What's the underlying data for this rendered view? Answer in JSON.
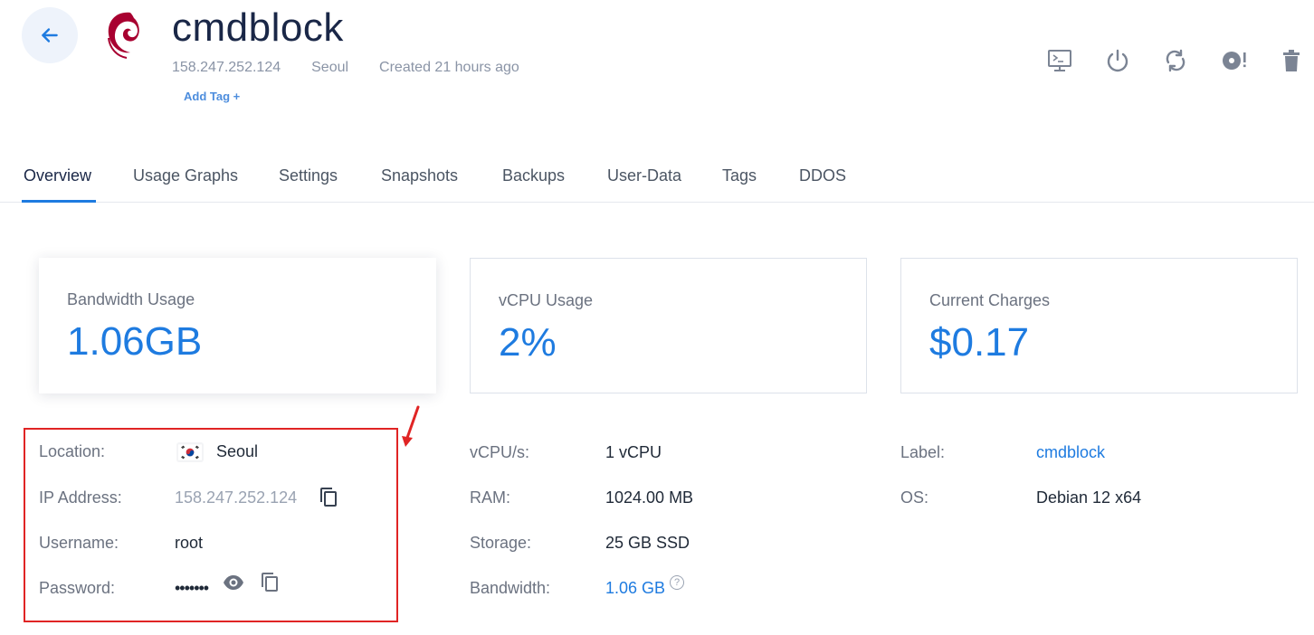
{
  "header": {
    "title": "cmdblock",
    "ip": "158.247.252.124",
    "location": "Seoul",
    "created": "Created 21 hours ago",
    "add_tag": "Add Tag +"
  },
  "actions": [
    "console-icon",
    "power-icon",
    "restart-icon",
    "reinstall-icon",
    "trash-icon"
  ],
  "tabs": [
    {
      "label": "Overview",
      "active": true
    },
    {
      "label": "Usage Graphs"
    },
    {
      "label": "Settings"
    },
    {
      "label": "Snapshots"
    },
    {
      "label": "Backups"
    },
    {
      "label": "User-Data"
    },
    {
      "label": "Tags"
    },
    {
      "label": "DDOS"
    }
  ],
  "cards": [
    {
      "label": "Bandwidth Usage",
      "value": "1.06GB"
    },
    {
      "label": "vCPU Usage",
      "value": "2%"
    },
    {
      "label": "Current Charges",
      "value": "$0.17"
    }
  ],
  "details": {
    "location": {
      "label": "Location:",
      "value": "Seoul"
    },
    "ip": {
      "label": "IP Address:",
      "value": "158.247.252.124"
    },
    "username": {
      "label": "Username:",
      "value": "root"
    },
    "password": {
      "label": "Password:",
      "value": "•••••••"
    },
    "vcpu": {
      "label": "vCPU/s:",
      "value": "1 vCPU"
    },
    "ram": {
      "label": "RAM:",
      "value": "1024.00 MB"
    },
    "storage": {
      "label": "Storage:",
      "value": "25 GB SSD"
    },
    "bandwidth": {
      "label": "Bandwidth:",
      "value": "1.06 GB"
    },
    "label": {
      "label": "Label:",
      "value": "cmdblock"
    },
    "os": {
      "label": "OS:",
      "value": "Debian 12 x64"
    }
  },
  "colors": {
    "accent": "#1e7be0",
    "highlight": "#e02424",
    "debian": "#a80030"
  }
}
